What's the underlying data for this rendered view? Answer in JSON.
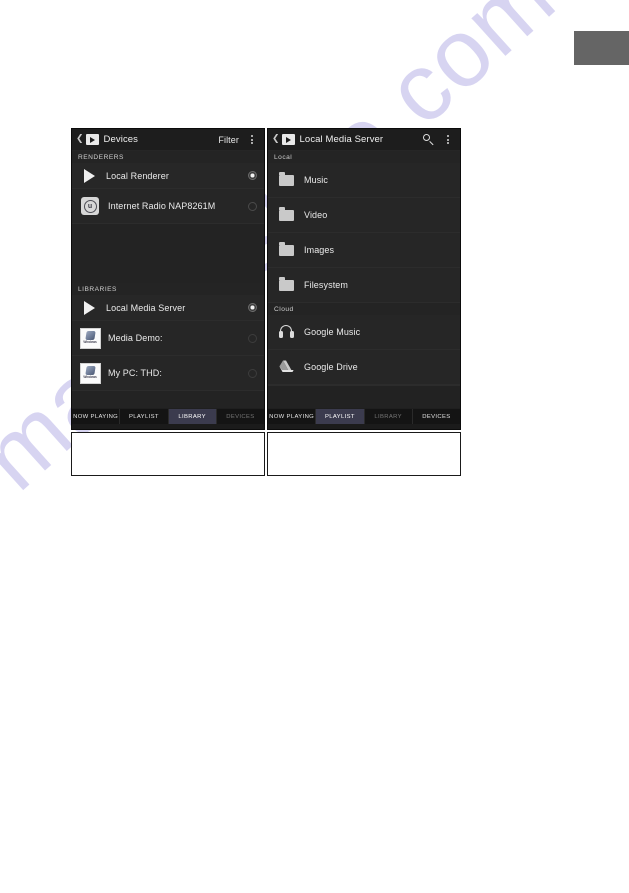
{
  "watermark": {
    "text": "manualslive.com"
  },
  "panels": [
    {
      "id": "devices-panel",
      "appbar": {
        "back_icon": "chevron-left-icon",
        "play_icon": "play-icon",
        "title": "Devices",
        "filter_label": "Filter",
        "overflow_icon": "overflow-menu-icon"
      },
      "sections": [
        {
          "header": "RENDERERS",
          "items": [
            {
              "icon": "play-icon",
              "label": "Local Renderer",
              "selected": true
            },
            {
              "icon": "internet-radio-icon",
              "label": "Internet Radio NAP8261M",
              "selected": false
            }
          ]
        },
        {
          "header": "LIBRARIES",
          "items": [
            {
              "icon": "play-icon",
              "label": "Local Media Server",
              "selected": true
            },
            {
              "icon": "windows-media-player-icon",
              "label": "Media Demo:",
              "selected": false
            },
            {
              "icon": "windows-media-player-icon",
              "label": "My PC:  THD:",
              "selected": false
            }
          ]
        }
      ],
      "tabs": [
        {
          "label": "NOW PLAYING",
          "state": "normal"
        },
        {
          "label": "PLAYLIST",
          "state": "normal"
        },
        {
          "label": "LIBRARY",
          "state": "active"
        },
        {
          "label": "DEVICES",
          "state": "dim"
        }
      ]
    },
    {
      "id": "local-media-server-panel",
      "appbar": {
        "back_icon": "chevron-left-icon",
        "play_icon": "play-icon",
        "title": "Local Media Server",
        "search_icon": "search-icon",
        "overflow_icon": "overflow-menu-icon"
      },
      "sections": [
        {
          "header": "Local",
          "items": [
            {
              "icon": "folder-icon",
              "label": "Music"
            },
            {
              "icon": "folder-icon",
              "label": "Video"
            },
            {
              "icon": "folder-icon",
              "label": "Images"
            },
            {
              "icon": "folder-icon",
              "label": "Filesystem"
            }
          ]
        },
        {
          "header": "Cloud",
          "items": [
            {
              "icon": "headphones-icon",
              "label": "Google Music"
            },
            {
              "icon": "google-drive-icon",
              "label": "Google Drive"
            }
          ]
        }
      ],
      "tabs": [
        {
          "label": "NOW PLAYING",
          "state": "normal"
        },
        {
          "label": "PLAYLIST",
          "state": "active"
        },
        {
          "label": "LIBRARY",
          "state": "dim"
        },
        {
          "label": "DEVICES",
          "state": "normal"
        }
      ]
    }
  ],
  "wmp_icon": {
    "line1": "Windows",
    "line2": "Media Player"
  },
  "radio_badge": {
    "letter": "u"
  },
  "colors": {
    "app_background": "#222222",
    "app_bar": "#1d1d1d",
    "tab_active": "#3b3b4e",
    "text_primary": "#eaeaea",
    "corner_box": "#656565",
    "watermark": "#3b2fbe"
  },
  "corner_box": {
    "label": ""
  }
}
